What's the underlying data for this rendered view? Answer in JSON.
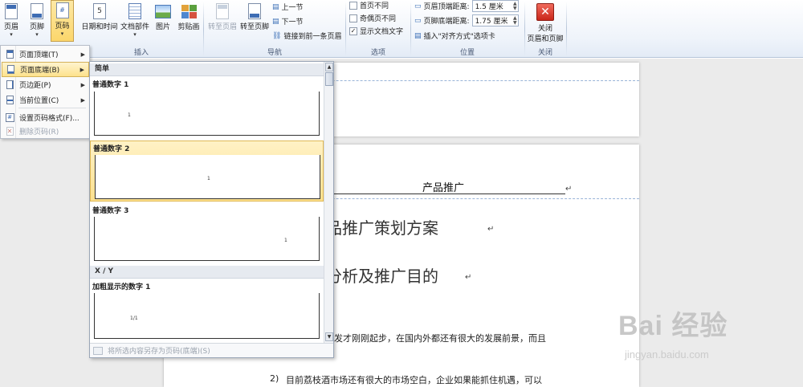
{
  "ribbon": {
    "header_label": "页眉",
    "footer_label": "页脚",
    "page_number_label": "页码",
    "date_time_label": "日期和时间",
    "doc_parts_label": "文档部件",
    "picture_label": "图片",
    "clipart_label": "剪贴画",
    "insert_group": "插入",
    "goto_header_label": "转至页眉",
    "goto_footer_label": "转至页脚",
    "prev_section_label": "上一节",
    "next_section_label": "下一节",
    "link_prev_label": "链接到前一条页眉",
    "nav_group": "导航",
    "first_page_diff": "首页不同",
    "odd_even_diff": "奇偶页不同",
    "show_doc_text": "显示文档文字",
    "options_group": "选项",
    "header_top_label": "页眉顶端距离:",
    "header_top_value": "1.5 厘米",
    "footer_bottom_label": "页脚底端距离:",
    "footer_bottom_value": "1.75 厘米",
    "insert_align_tab": "插入\"对齐方式\"选项卡",
    "position_group": "位置",
    "close_label_1": "关闭",
    "close_label_2": "页眉和页脚",
    "close_group": "关闭"
  },
  "menu": {
    "items": [
      {
        "label": "页面顶端(T)",
        "has_sub": true
      },
      {
        "label": "页面底端(B)",
        "has_sub": true
      },
      {
        "label": "页边距(P)",
        "has_sub": true
      },
      {
        "label": "当前位置(C)",
        "has_sub": true
      },
      {
        "label": "设置页码格式(F)...",
        "has_sub": false
      },
      {
        "label": "删除页码(R)",
        "has_sub": false
      }
    ]
  },
  "gallery": {
    "section_simple": "简单",
    "item1": "普通数字 1",
    "item2": "普通数字 2",
    "item3": "普通数字 3",
    "section_xy": "X / Y",
    "item4": "加粗显示的数字 1",
    "footer_text": "将所选内容另存为页码(底端)(S)",
    "thumb_num": "1",
    "thumb_num_xy": "1/1"
  },
  "document": {
    "header_text": "产品推广",
    "title1": "品推广策划方案",
    "title2": "分析及推广目的",
    "para1": "发才刚刚起步，在国内外都还有很大的发展前景，而且",
    "para2_num": "2)",
    "para2": "目前荔枝酒市场还有很大的市场空白，企业如果能抓住机遇，可以",
    "para_mark": "↵"
  },
  "watermark": {
    "brand": "Bai 经验",
    "url": "jingyan.baidu.com"
  },
  "colors": {
    "accent": "#fcd66b",
    "ribbon_bg": "#eef3fa",
    "doc_bg": "#ebebeb"
  }
}
